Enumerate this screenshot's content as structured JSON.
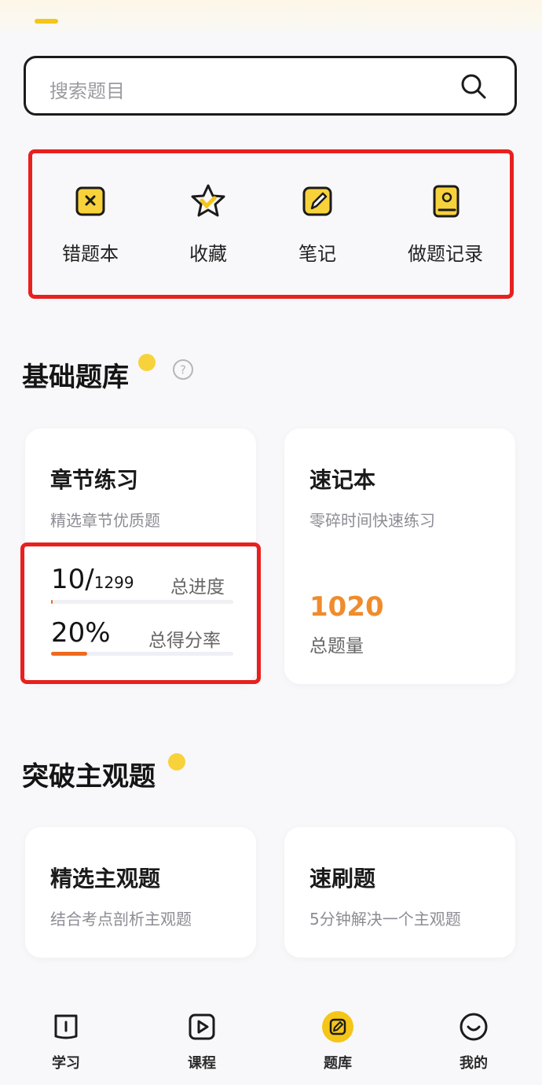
{
  "search": {
    "placeholder": "搜索题目",
    "icon": "search-icon"
  },
  "quick_actions": [
    {
      "label": "错题本",
      "icon": "wrong-book-icon"
    },
    {
      "label": "收藏",
      "icon": "star-icon"
    },
    {
      "label": "笔记",
      "icon": "note-icon"
    },
    {
      "label": "做题记录",
      "icon": "record-icon"
    }
  ],
  "basic_bank": {
    "title": "基础题库",
    "help_icon": "help-icon",
    "chapter_card": {
      "title": "章节练习",
      "subtitle": "精选章节优质题",
      "progress_done": "10/",
      "progress_total": "1299",
      "progress_label": "总进度",
      "progress_fraction": 0.0077,
      "score_rate": "20%",
      "score_label": "总得分率",
      "score_fraction": 0.2
    },
    "memo_card": {
      "title": "速记本",
      "subtitle": "零碎时间快速练习",
      "count": "1020",
      "count_label": "总题量"
    }
  },
  "subjective": {
    "title": "突破主观题",
    "cards": [
      {
        "title": "精选主观题",
        "subtitle": "结合考点剖析主观题"
      },
      {
        "title": "速刷题",
        "subtitle": "5分钟解决一个主观题"
      }
    ]
  },
  "bottom_nav": [
    {
      "label": "学习",
      "icon": "study-icon",
      "active": false
    },
    {
      "label": "课程",
      "icon": "course-icon",
      "active": false
    },
    {
      "label": "题库",
      "icon": "question-bank-icon",
      "active": true
    },
    {
      "label": "我的",
      "icon": "profile-icon",
      "active": false
    }
  ],
  "colors": {
    "accent": "#f5c518",
    "highlight": "#e8201e",
    "orange": "#f08c2b"
  }
}
